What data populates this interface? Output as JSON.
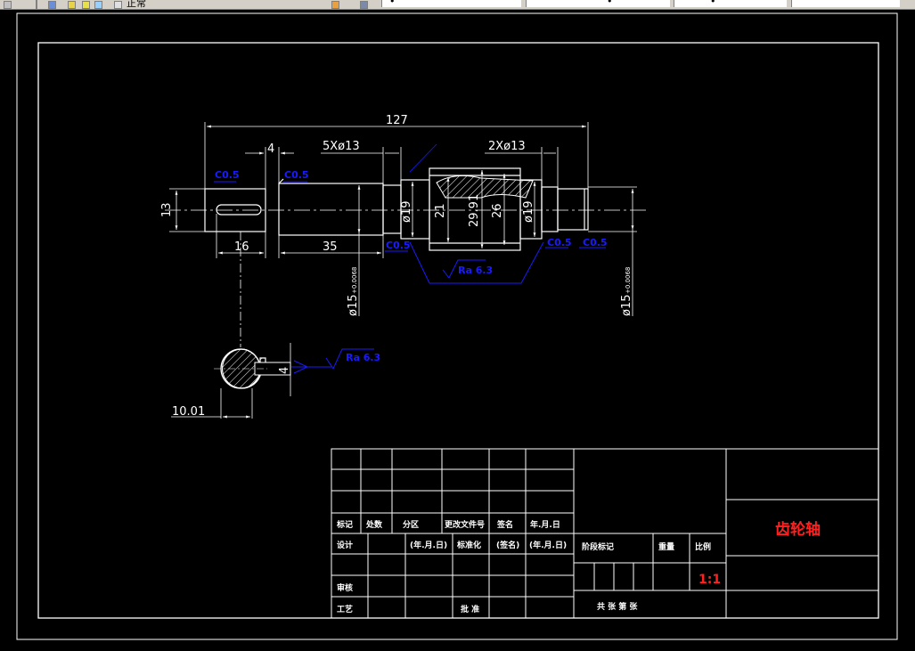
{
  "toolbar": {
    "layer_name": "正常",
    "field_1_text": "•",
    "field_2_text": "•",
    "field_3_text": "•"
  },
  "colors": {
    "background": "#000000",
    "line": "#ffffff",
    "annotation": "#1a1aff",
    "title": "#ff2020",
    "scale": "#ff2020"
  },
  "drawing": {
    "dimensions": {
      "overall_length": "127",
      "width_4": "4",
      "holes_left": "5Xø13",
      "holes_right": "2Xø13",
      "dia_13": "13",
      "keyway_16": "16",
      "length_35": "35",
      "dia_19_left": "ø19",
      "dia_21": "21",
      "dia_29_91": "29.91",
      "dia_26": "26",
      "dia_19_right": "ø19",
      "dia_15_left": "ø15",
      "tol_left": "+0.0068",
      "dia_15_right": "ø15",
      "tol_right": "+0.0068",
      "section_width": "4",
      "section_depth": "10.01"
    },
    "annotations": {
      "chamfer_1": "C0.5",
      "chamfer_2": "C0.5",
      "chamfer_3": "C0.5",
      "chamfer_4": "C0.5",
      "chamfer_5": "C0.5",
      "roughness_1": "Ra 6.3",
      "roughness_2": "Ra 6.3"
    }
  },
  "title_block": {
    "part_name": "齿轮轴",
    "scale": "1:1",
    "row_labels": {
      "mark": "标记",
      "count": "处数",
      "zone": "分区",
      "doc_no": "更改文件号",
      "sign": "签名",
      "date": "年.月.日",
      "design": "设计",
      "design_date": "(年.月.日)",
      "standard": "标准化",
      "sign2": "(签名)",
      "date2": "(年.月.日)",
      "review": "审核",
      "process": "工艺",
      "approve": "批 准"
    },
    "stage_mark": "阶段标记",
    "weight": "重量",
    "ratio": "比例",
    "sheets": "共 张 第 张"
  }
}
